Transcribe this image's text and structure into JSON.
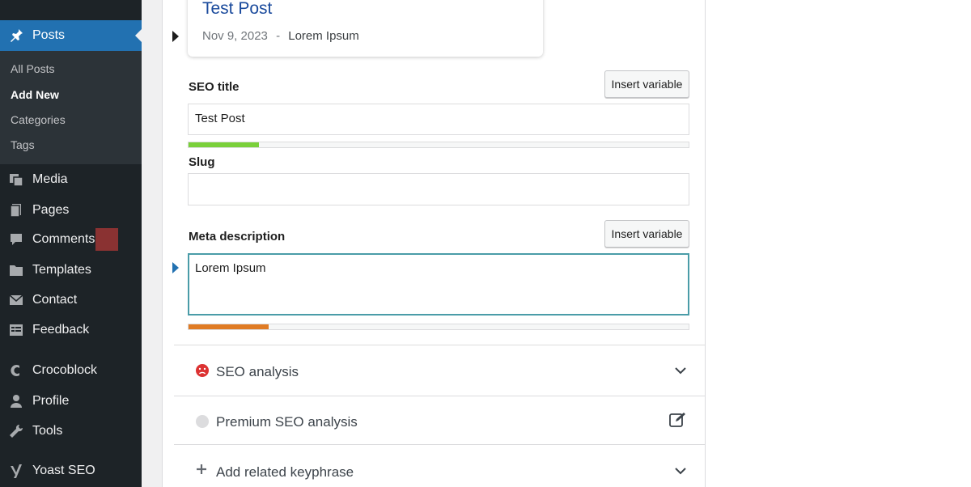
{
  "sidebar": {
    "items": [
      {
        "label": "Posts",
        "icon": "pin-icon"
      },
      {
        "label": "Media",
        "icon": "media-icon"
      },
      {
        "label": "Pages",
        "icon": "pages-icon"
      },
      {
        "label": "Comments",
        "icon": "comments-icon"
      },
      {
        "label": "Templates",
        "icon": "folder-icon"
      },
      {
        "label": "Contact",
        "icon": "mail-icon"
      },
      {
        "label": "Feedback",
        "icon": "feedback-icon"
      },
      {
        "label": "Crocoblock",
        "icon": "crocoblock-icon"
      },
      {
        "label": "Profile",
        "icon": "user-icon"
      },
      {
        "label": "Tools",
        "icon": "wrench-icon"
      },
      {
        "label": "Yoast SEO",
        "icon": "yoast-icon"
      }
    ],
    "submenu": [
      "All Posts",
      "Add New",
      "Categories",
      "Tags"
    ]
  },
  "preview": {
    "title": "Test Post",
    "date": "Nov 9, 2023",
    "separator": "-",
    "description": "Lorem Ipsum"
  },
  "seo_title": {
    "label": "SEO title",
    "insert_label": "Insert variable",
    "value": "Test Post",
    "progress": 0.14,
    "progress_color": "#7ad03a"
  },
  "slug": {
    "label": "Slug",
    "value": ""
  },
  "meta_description": {
    "label": "Meta description",
    "insert_label": "Insert variable",
    "value": "Lorem Ipsum",
    "progress": 0.16,
    "progress_color": "#e07b24"
  },
  "sections": [
    {
      "title": "SEO analysis",
      "lead_icon": "sad-face-icon",
      "trail_icon": "chevron-down-icon"
    },
    {
      "title": "Premium SEO analysis",
      "lead_icon": "grey-dot-icon",
      "trail_icon": "edit-icon"
    },
    {
      "title": "Add related keyphrase",
      "lead_icon": "plus-icon",
      "trail_icon": "chevron-down-icon"
    }
  ],
  "colors": {
    "sidebar_bg": "#1d2327",
    "active_bg": "#2271b1",
    "link_blue": "#1a4a9c",
    "bad_red": "#dc3232"
  }
}
